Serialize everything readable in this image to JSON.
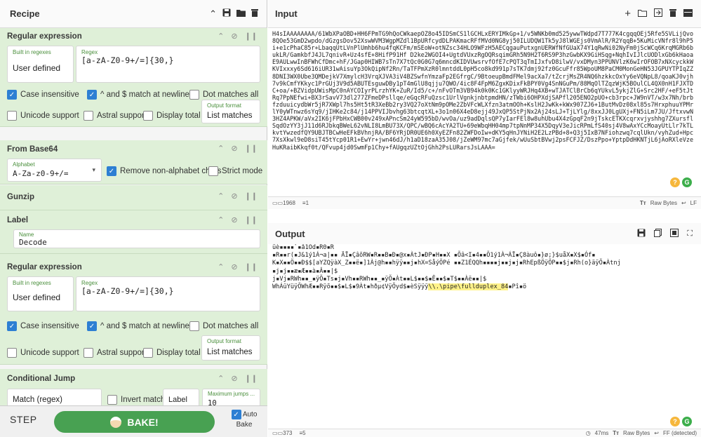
{
  "recipe": {
    "title": "Recipe",
    "operations": [
      {
        "name": "Regular expression",
        "builtin_label": "Built in regexes",
        "builtin_value": "User defined",
        "regex_label": "Regex",
        "regex_value": "[a-zA-Z0-9+/=]{30,}",
        "case_insensitive": "Case insensitive",
        "multiline": "^ and $ match at newlines",
        "dotall": "Dot matches all",
        "unicode": "Unicode support",
        "astral": "Astral support",
        "display_total": "Display total",
        "output_format_label": "Output format",
        "output_format_value": "List matches"
      },
      {
        "name": "From Base64",
        "alphabet_label": "Alphabet",
        "alphabet_value": "A-Za-z0-9+/=",
        "remove_non_alpha": "Remove non-alphabet chars",
        "strict_mode": "Strict mode"
      },
      {
        "name": "Gunzip"
      },
      {
        "name": "Label",
        "name_label": "Name",
        "name_value": "Decode"
      },
      {
        "name": "Regular expression",
        "builtin_label": "Built in regexes",
        "builtin_value": "User defined",
        "regex_label": "Regex",
        "regex_value": "[a-zA-Z0-9+/=]{30,}",
        "case_insensitive": "Case insensitive",
        "multiline": "^ and $ match at newlines",
        "dotall": "Dot matches all",
        "unicode": "Unicode support",
        "astral": "Astral support",
        "display_total": "Display total",
        "output_format_label": "Output format",
        "output_format_value": "List matches"
      },
      {
        "name": "Conditional Jump",
        "match_value": "Match (regex)",
        "invert": "Invert match",
        "label_value": "Label n...",
        "max_jumps_label": "Maximum jumps ...",
        "max_jumps_value": "10"
      }
    ],
    "step": "STEP",
    "bake": "BAKE!",
    "auto_bake": "Auto Bake"
  },
  "input": {
    "title": "Input",
    "text": "H4sIAAAAAAAA/61WbXPaOBD+HH6FPmTG9hQoCWkaepOZ8o45IDSmCS1lGCHLxERYIMkGp+1/v5WNKb0md525ywwTWdpd7T777K4cgqqOEj5Rfe5SVLijQvo8QOe53GmD2wpdo/dGzgsDov52XswWVM3WgpMZdl1BpURfcydDLPAKmacRFfMVd0NG8yj50ILUDQW1Tk5yJ8lWGEjs0VmAlR/R2YqqB+5KuMicVNfr8l9hP5i+e1cPhaC85r+LbaqqUtLVnPlUmhb6hu4fqKCFm/mSEoW+otNZsc34HLO9WFzH5AECqgauPutxgnUERWfNfGUaX74Y1qRwNi02NyFm0jScWCq6KrqMGRb6bukLR/GamkbfJ4JL7qnivR+Uz4sfE+8HifP91Hf D2ke2WGOI4+UgtdVUxzRgOQRsqimGRh5N9H2T6RS9P3hzGwbKX9GiHSqg+NqhIvIJlcUODlxGb6kHaoaE9AULwwInBFWhCfDmc+hF/JGap0HIWB7sTn7X7tQc0G0G7q6mncdKIDVUwsrvfOfE7cPQT3qTmIJxfvD8ilwV/vxDMyn3PPUNVlzK6wIrOFOB7xNXcyckkWKVIxxxy6Sd616iUR31wAisuYp3OkQipNf2Rn/TaTFPmXzR0lmntddL0pH5co8kd991p7sTK7dmj92fz0GcuFfr85WpoUM8PaCM0MonGeHN53JGPUYTPIqZZ8DNI3WX0Ube3QMDejkV7XmylcH3VrqXJVA3iV4BZSwfnYmzaFp2EGfrgC/9BtoeupBmdFMel9acXa7/tZcrjMsZR4NQ6hzkkcOxYy6eVQNpL8/qoaKJ0vjh7v9kCmfYKkyc1PrGUj3V9d5ABUTEsguwDBy1pT4mGlU8qjju7QWO/4ic8F4FpM6ZgxKDixFkBPY0Vg4SnNGuPm/88MqOlTZqzWjK5BOulCL4QX0nH1FJXTDC+oa/+BZVidpUWisMpC0nAYCOIyrPLrzhYK+ZuR/Id5/c+/nFvOTm3VB94k0k0Kc1GKlyyWRJHq4XB+wTJATClBrCb6qYUkvL5ykjZlG+Src2HF/+eF5tJtRq7PpNEfwi+BX3rSavV73dl277ZFmeDPsllqe/eGqcRFuQzsc1UrlVgnkjnbtpmdHN/zTWbi6OHPXdjSAPfl205ENO2pUO+cb3rpc+JW9nVT/w3x7Nh/brbfzduuicydbWr5jR7XWpl7hs5Ht5tR3XeBb2ry3VQ27oXtNm9pOMe2ZbVFcWLXfzn3atmOOh+KslH2JwKk+kWx907ZJ6+1ButMvDz08xl85s7HrxphuuYPMrlY0yWTnwz6sYq9/jIHKe2c84/j14PPVIJbvhg63btcqtXL+3o1n06X4eD8ejj49JxQP5StPjNx2Aj24sLJ+TjLYlg/8xxJJ0LgUXj+FN5iLm7JU/JftxvwN3HZ4APKW/aVx2IK6jFPbHxCWB00v249xAPncSm24yW595bD/wvOa/uz9adDqlsQP7yIarFEl8w8uhUbu4X4zGpqF2n9jTskcETKXcqrxvjyshhg7ZXursflSqdOzYY3jJ11d6RJbkqBWeL62vNLI8LmBU73X/QPC/wBQ6cAcYA2TU+69eWbqHH04mp7tpNnMP34X5DqyV3eJicRPmLfS40sj4V8wAxYCcMoayUtLlr7kTLkvtYwzedfQY9UBJTBCwHeEFkBVhnjRA/BF6YRjDR0UE6h0XyEZFn82ZWFDoIw+dKY5qHnJYNiH2E2LzPBd+8+Q3j5IxB7NFiohzwq7cqlUkn/vyhZud+Hpc7XsXkwl9eD8siT45tYcp01R1+EwYr+jwn46dJ/h1aD18zaA35J08/jZeWM97mc7aGjfek/wUuSbtBVwj2psFCFJZ/DszPpo+YptpDdHKNTjL6jAoRXleVzeHuKRaibKkqf0t/QFvup4jd0SwmFp1Chy+fAUgqzUZtOjGhh2PsLURarsJsLAAA="
  },
  "input_status": {
    "length": "1968",
    "lines": "1",
    "font": "Raw Bytes",
    "eol": "LF"
  },
  "output": {
    "title": "Output",
    "line1": "üè▪▪▪▪`▪å1Ôd▪R0▪R",
    "line2": "▪R▪▪r(▪J&1ý1Á¬a|▪▪ ÄÏ▪ÇâõRW▪R▪▪B▪Ð▪@x▪ÀtJ▪ÐP▪H▪▪X ▪Õâ<I▪4▪▪Õ1ý1À¬ÁÏ▪Ç8àuô▪}ø;}$uåX▪X$▪Óf▪",
    "line3": "K▪X▪▪Ö▪▪Ð$$[aYZQÿàX_Z▪▪ë▪]1Àj@h▪▪hÿÿ▪▪j▪hX=SåýÖPé ▪▪Z1ÉQQh▪▪▪▪j▪▪j▪j▪RhEpßÖÿÕP▪▪$j▪Rh(o}äÿÕ▪Àtnj",
    "line4": "▪j▪j▪▪æ▪Æ▪▪à▪Â▪▪|$",
    "line5": "j▪Vj▪RWh▪▪_▪ÿÕ▪Ts▪j▪Vh▪▪RWh▪▪_▪ÿÕ▪Àt▪▪L$▪▪$▪Ê▪▪$▪T$▪▪Àë▪▪|$",
    "line6_pre": "WhÁüYüÿÕWhÆ▪▪Rÿõ▪▪$▪L$▪9Àt▪hðµ¢VÿÕyd$▪èSÿÿÿ",
    "line6_hl": "\\\\.\\pipe\\fullduplex_84",
    "line6_post": "▪Pî▪ö"
  },
  "output_status": {
    "length": "373",
    "lines": "5",
    "time": "47ms",
    "font": "Raw Bytes",
    "eol": "FF (detected)"
  }
}
